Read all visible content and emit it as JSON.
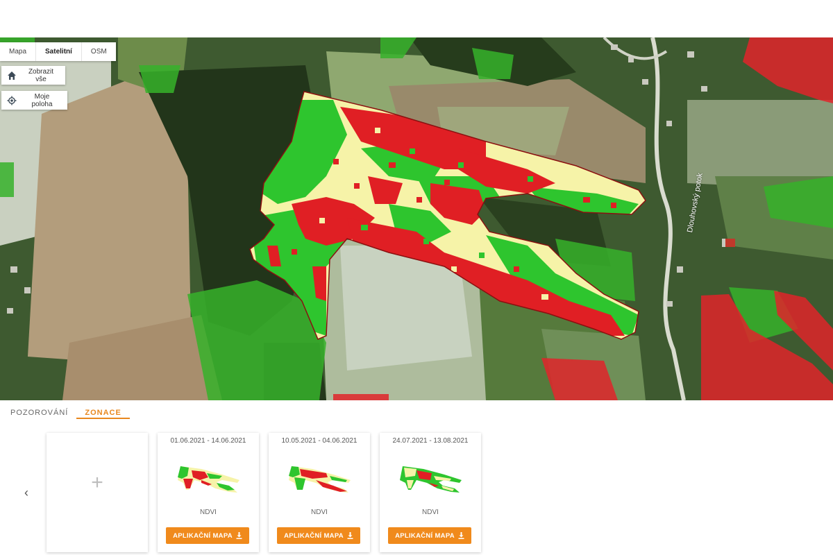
{
  "map": {
    "types": [
      "Mapa",
      "Satelitní",
      "OSM"
    ],
    "active_type": "Satelitní",
    "show_all_label": "Zobrazit vše",
    "my_location_label": "Moje poloha",
    "stream_label": "Dlouhovský potok"
  },
  "tabs": {
    "observation_label": "POZOROVÁNÍ",
    "zoning_label": "ZONACE",
    "active": "ZONACE"
  },
  "add_card": {
    "icon": "plus-icon",
    "label": "+"
  },
  "cards": [
    {
      "date": "01.06.2021 - 14.06.2021",
      "index": "NDVI",
      "button": "APLIKAČNÍ MAPA"
    },
    {
      "date": "10.05.2021 - 04.06.2021",
      "index": "NDVI",
      "button": "APLIKAČNÍ MAPA"
    },
    {
      "date": "24.07.2021 - 13.08.2021",
      "index": "NDVI",
      "button": "APLIKAČNÍ MAPA"
    }
  ],
  "colors": {
    "accent": "#f08a1c",
    "zone_high": "#2ec52e",
    "zone_mid": "#f6f3a8",
    "zone_low": "#e01f24"
  }
}
